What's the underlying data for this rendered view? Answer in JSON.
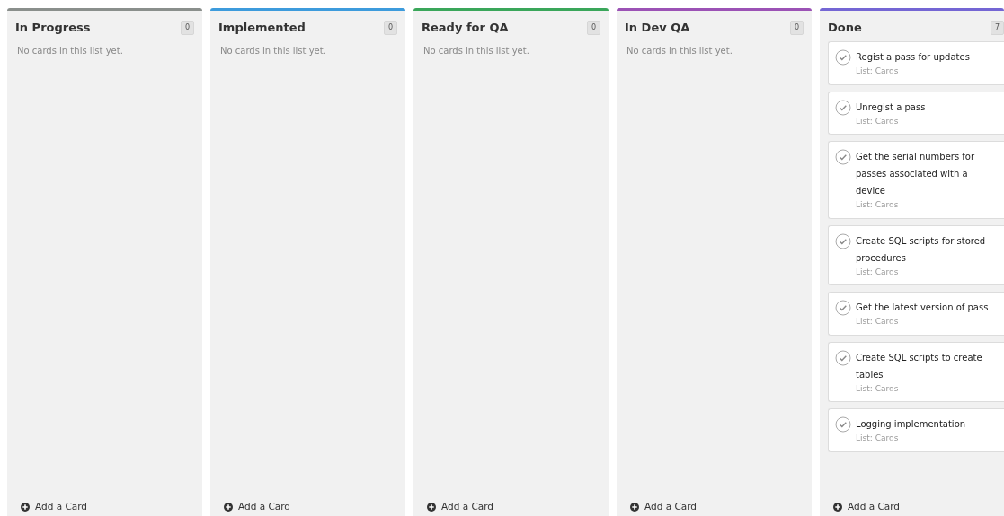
{
  "lists": [
    {
      "title": "In Progress",
      "count": "0",
      "color": "#8a8f8c",
      "empty_text": "No cards in this list yet.",
      "add_label": "Add a Card"
    },
    {
      "title": "Implemented",
      "count": "0",
      "color": "#3d9bdc",
      "empty_text": "No cards in this list yet.",
      "add_label": "Add a Card"
    },
    {
      "title": "Ready for QA",
      "count": "0",
      "color": "#3aa65a",
      "empty_text": "No cards in this list yet.",
      "add_label": "Add a Card"
    },
    {
      "title": "In Dev QA",
      "count": "0",
      "color": "#9b52b5",
      "empty_text": "No cards in this list yet.",
      "add_label": "Add a Card"
    },
    {
      "title": "Done",
      "count": "7",
      "color": "#7466d4",
      "cards": [
        {
          "title": "Regist a pass for updates",
          "subtitle": "List: Cards"
        },
        {
          "title": "Unregist a pass",
          "subtitle": "List: Cards"
        },
        {
          "title": "Get the serial numbers for passes associated with a device",
          "subtitle": "List: Cards"
        },
        {
          "title": "Create SQL scripts for stored procedures",
          "subtitle": "List: Cards"
        },
        {
          "title": "Get the latest version of pass",
          "subtitle": "List: Cards"
        },
        {
          "title": "Create SQL scripts to create tables",
          "subtitle": "List: Cards"
        },
        {
          "title": "Logging implementation",
          "subtitle": "List: Cards"
        }
      ],
      "add_label": "Add a Card"
    }
  ]
}
